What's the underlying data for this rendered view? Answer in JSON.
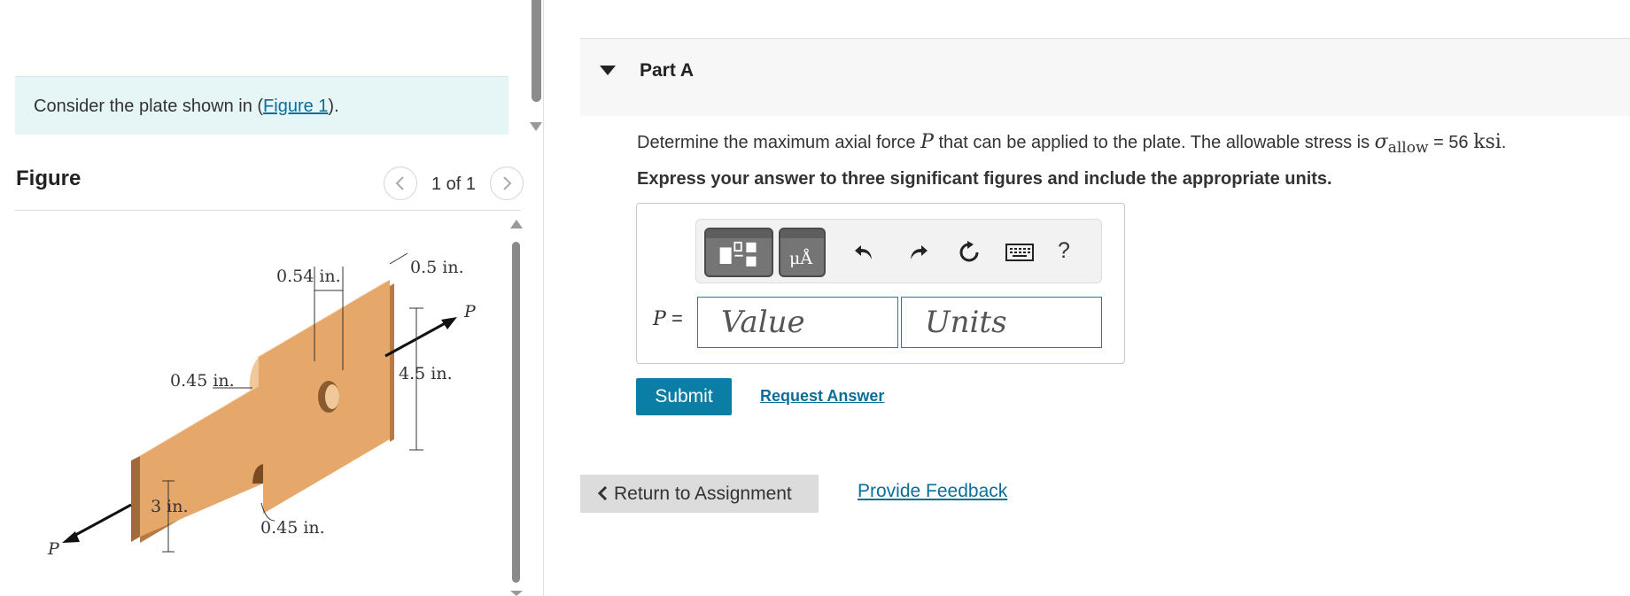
{
  "intro": {
    "text_before": "Consider the plate shown in (",
    "figure_link": "Figure 1",
    "text_after": ")."
  },
  "figure": {
    "heading": "Figure",
    "counter": "1 of 1",
    "labels": {
      "top_notch": "0.54 in.",
      "top_right": "0.5 in.",
      "force_right": "P",
      "height": "4.5 in.",
      "left_radius": "0.45 in.",
      "bottom_radius": "0.45 in.",
      "thickness": "3 in.",
      "force_left": "P"
    },
    "plate_color": "#e5a86a"
  },
  "part": {
    "title": "Part A",
    "question_before": "Determine the maximum axial force",
    "question_var": "P",
    "question_middle": "that can be applied to the plate. The allowable stress is",
    "sigma": "σ",
    "sigma_sub": "allow",
    "question_eq": "= 56",
    "question_unit": "ksi",
    "question_end": ".",
    "instruction": "Express your answer to three significant figures and include the appropriate units.",
    "input_label_var": "P",
    "input_label_eq": "=",
    "units_button_glyph": "μÅ",
    "help_glyph": "?",
    "value_placeholder": "Value",
    "units_placeholder": "Units",
    "submit_label": "Submit",
    "request_answer_label": "Request Answer"
  },
  "footer": {
    "return_label": "Return to Assignment",
    "feedback_label": "Provide Feedback"
  },
  "colors": {
    "accent": "#0b7ea5",
    "link": "#0b6e99",
    "intro_bg": "#e6f5f6"
  }
}
